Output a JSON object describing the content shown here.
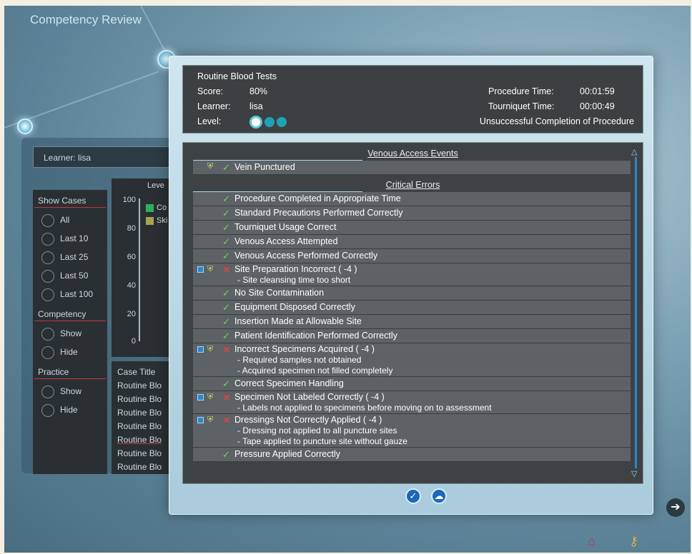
{
  "window": {
    "title": "Competency Review"
  },
  "background": {
    "learner_label": "Learner:",
    "learner_name": "lisa",
    "chart_tick_labels": [
      "100",
      "80",
      "60",
      "40",
      "20",
      "0"
    ],
    "chart_header_fragment": "Leve",
    "legend_fragments": [
      "Co",
      "Ski"
    ],
    "show_cases": {
      "header": "Show Cases",
      "options": [
        "All",
        "Last 10",
        "Last 25",
        "Last 50",
        "Last 100"
      ]
    },
    "competency": {
      "header": "Competency",
      "options": [
        "Show",
        "Hide"
      ]
    },
    "practice": {
      "header": "Practice",
      "options": [
        "Show",
        "Hide"
      ]
    },
    "case_title_header": "Case Title",
    "case_rows": [
      "Routine Blo",
      "Routine Blo",
      "Routine Blo",
      "Routine Blo",
      "Routine Blo",
      "Routine Blo",
      "Routine Blo"
    ]
  },
  "summary": {
    "procedure_name": "Routine Blood Tests",
    "score_label": "Score:",
    "score_value": "80%",
    "learner_label": "Learner:",
    "learner_value": "lisa",
    "level_label": "Level:",
    "procedure_time_label": "Procedure Time:",
    "procedure_time_value": "00:01:59",
    "tourniquet_time_label": "Tourniquet Time:",
    "tourniquet_time_value": "00:00:49",
    "completion_status": "Unsuccessful Completion of Procedure"
  },
  "venous_access_events": {
    "header": "Venous Access Events",
    "items": [
      {
        "text": "Vein Punctured",
        "status": "pass"
      }
    ]
  },
  "critical_errors": {
    "header": "Critical Errors",
    "items": [
      {
        "text": "Procedure Completed in Appropriate Time",
        "status": "pass"
      },
      {
        "text": "Standard Precautions Performed Correctly",
        "status": "pass"
      },
      {
        "text": "Tourniquet Usage Correct",
        "status": "pass"
      },
      {
        "text": "Venous Access Attempted",
        "status": "pass"
      },
      {
        "text": "Venous Access Performed Correctly",
        "status": "pass"
      },
      {
        "text": "Site Preparation Incorrect ( -4 )",
        "status": "fail",
        "details": [
          "- Site cleansing time too short"
        ]
      },
      {
        "text": "No Site Contamination",
        "status": "pass"
      },
      {
        "text": "Equipment Disposed Correctly",
        "status": "pass"
      },
      {
        "text": "Insertion Made at Allowable Site",
        "status": "pass"
      },
      {
        "text": "Patient Identification Performed Correctly",
        "status": "pass"
      },
      {
        "text": "Incorrect Specimens Acquired ( -4 )",
        "status": "fail",
        "details": [
          "- Required samples not obtained",
          "- Acquired specimen not filled completely"
        ]
      },
      {
        "text": "Correct Specimen Handling",
        "status": "pass"
      },
      {
        "text": "Specimen Not Labeled Correctly ( -4 )",
        "status": "fail",
        "details": [
          "- Labels not applied to specimens before moving on to assessment"
        ]
      },
      {
        "text": "Dressings Not Correctly Applied ( -4 )",
        "status": "fail",
        "details": [
          "- Dressing not applied to all puncture sites",
          "- Tape applied to puncture site without gauze"
        ]
      },
      {
        "text": "Pressure Applied Correctly",
        "status": "pass"
      }
    ]
  },
  "colors": {
    "pass": "#77d06a",
    "fail": "#e2453c",
    "accent": "#2f86c9"
  },
  "icons": {
    "pass": "check-icon",
    "fail": "x-icon",
    "collapse": "minus-icon",
    "detail": "mask-icon"
  },
  "dialog_buttons": [
    {
      "name": "ok-button",
      "icon": "check-icon"
    },
    {
      "name": "cloud-button",
      "icon": "cloud-icon"
    }
  ]
}
